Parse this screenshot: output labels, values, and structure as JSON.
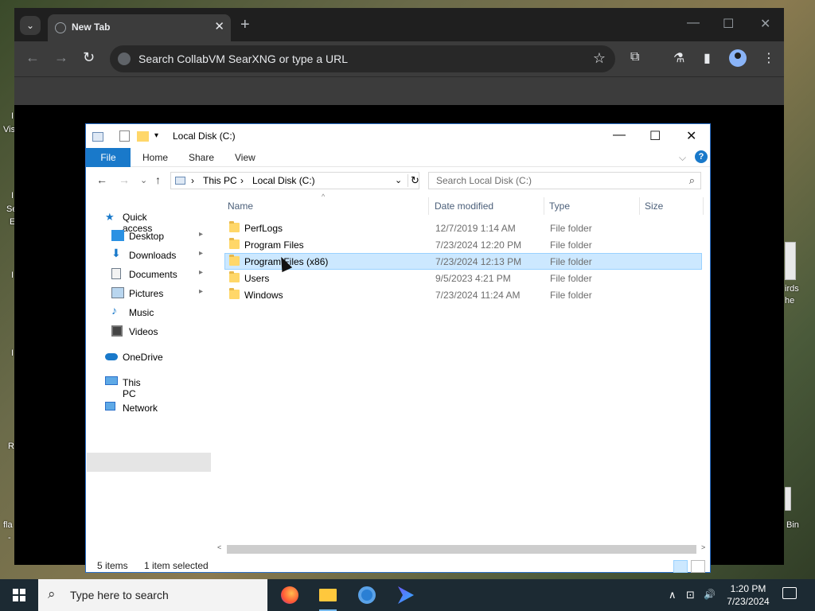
{
  "desktop": {
    "left_frags": [
      "I",
      "Vis",
      "I",
      "Se",
      "E",
      "I",
      "I",
      "R",
      "fla",
      "-"
    ],
    "right_frags": [
      "irds",
      "he",
      "Bin"
    ]
  },
  "chrome": {
    "tab_title": "New Tab",
    "tab_close": "✕",
    "new_tab": "+",
    "min": "—",
    "max": "☐",
    "close": "✕",
    "back": "←",
    "forward": "→",
    "reload": "↻",
    "omnibox_placeholder": "Search CollabVM SearXNG or type a URL",
    "bookmark": "☆",
    "extensions": "⧉",
    "labs": "⚗",
    "sidepanel": "▮",
    "menu": "⋮"
  },
  "explorer": {
    "title": "Local Disk (C:)",
    "min": "—",
    "max": "☐",
    "close": "✕",
    "ribbon": {
      "file": "File",
      "home": "Home",
      "share": "Share",
      "view": "View",
      "help": "?",
      "expand": "⌵"
    },
    "nav": {
      "back": "←",
      "forward": "→",
      "recent": "⌄",
      "up": "↑"
    },
    "address": {
      "sep1": "›",
      "this_pc": "This PC",
      "sep2": "›",
      "drive": "Local Disk (C:)",
      "dropdown": "⌄",
      "refresh": "↻"
    },
    "search_placeholder": "Search Local Disk (C:)",
    "search_icon": "⌕",
    "sidebar": {
      "quick_access": "Quick access",
      "desktop": "Desktop",
      "downloads": "Downloads",
      "documents": "Documents",
      "pictures": "Pictures",
      "music": "Music",
      "videos": "Videos",
      "onedrive": "OneDrive",
      "this_pc": "This PC",
      "network": "Network",
      "pin": "📌"
    },
    "columns": {
      "name": "Name",
      "date": "Date modified",
      "type": "Type",
      "size": "Size",
      "sort": "^"
    },
    "rows": [
      {
        "name": "PerfLogs",
        "date": "12/7/2019 1:14 AM",
        "type": "File folder"
      },
      {
        "name": "Program Files",
        "date": "7/23/2024 12:20 PM",
        "type": "File folder"
      },
      {
        "name": "Program Files (x86)",
        "date": "7/23/2024 12:13 PM",
        "type": "File folder"
      },
      {
        "name": "Users",
        "date": "9/5/2023 4:21 PM",
        "type": "File folder"
      },
      {
        "name": "Windows",
        "date": "7/23/2024 11:24 AM",
        "type": "File folder"
      }
    ],
    "selected_row": 2,
    "scroll_left": "<",
    "scroll_right": ">",
    "status": {
      "count": "5 items",
      "selection": "1 item selected"
    }
  },
  "taskbar": {
    "search_placeholder": "Type here to search",
    "search_icon": "⌕",
    "tray_chevron": "∧",
    "network": "⊡",
    "volume": "🔊",
    "time": "1:20 PM",
    "date": "7/23/2024"
  }
}
